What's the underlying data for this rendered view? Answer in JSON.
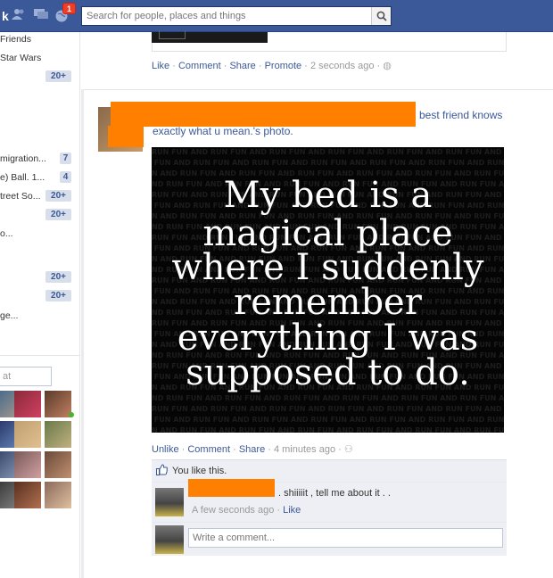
{
  "topbar": {
    "notification_count": "1",
    "search_placeholder": "Search for people, places and things",
    "icons": [
      "facebook-logo-icon",
      "friend-requests-icon",
      "messages-icon",
      "notifications-globe-icon",
      "search-icon"
    ],
    "brand_color": "#3b5998",
    "badge_color": "#f03d25"
  },
  "sidebar": {
    "items": [
      {
        "label": "Friends"
      },
      {
        "label": "Star Wars"
      },
      {
        "label": "migration..."
      },
      {
        "label": "e) Ball. 1..."
      },
      {
        "label": "treet So..."
      },
      {
        "label": "o..."
      },
      {
        "label": "ge..."
      }
    ],
    "counts": [
      "20+",
      "7",
      "4",
      "20+",
      "20+",
      "20+",
      "20+"
    ],
    "chat_search_placeholder": "at"
  },
  "previous_post": {
    "actions": {
      "like": "Like",
      "comment": "Comment",
      "share": "Share",
      "promote": "Promote",
      "time": "2 seconds ago"
    }
  },
  "post": {
    "header_link": "best friend knows",
    "header_line2": "exactly what u mean.'s photo.",
    "photo_text_lines": [
      "My bed is a",
      "magical place",
      "where I suddenly",
      "remember",
      "everything I was",
      "supposed to do."
    ],
    "photo_bg_word": "RUN FUN AND ",
    "actions": {
      "unlike": "Unlike",
      "comment": "Comment",
      "share": "Share",
      "time": "4 minutes ago"
    },
    "likes_text": "You like this.",
    "comment": {
      "text": ". shiiiiit , tell me about it . .",
      "time": "A few seconds ago",
      "like": "Like"
    },
    "write_placeholder": "Write a comment...",
    "redaction_color": "#ff8000"
  }
}
